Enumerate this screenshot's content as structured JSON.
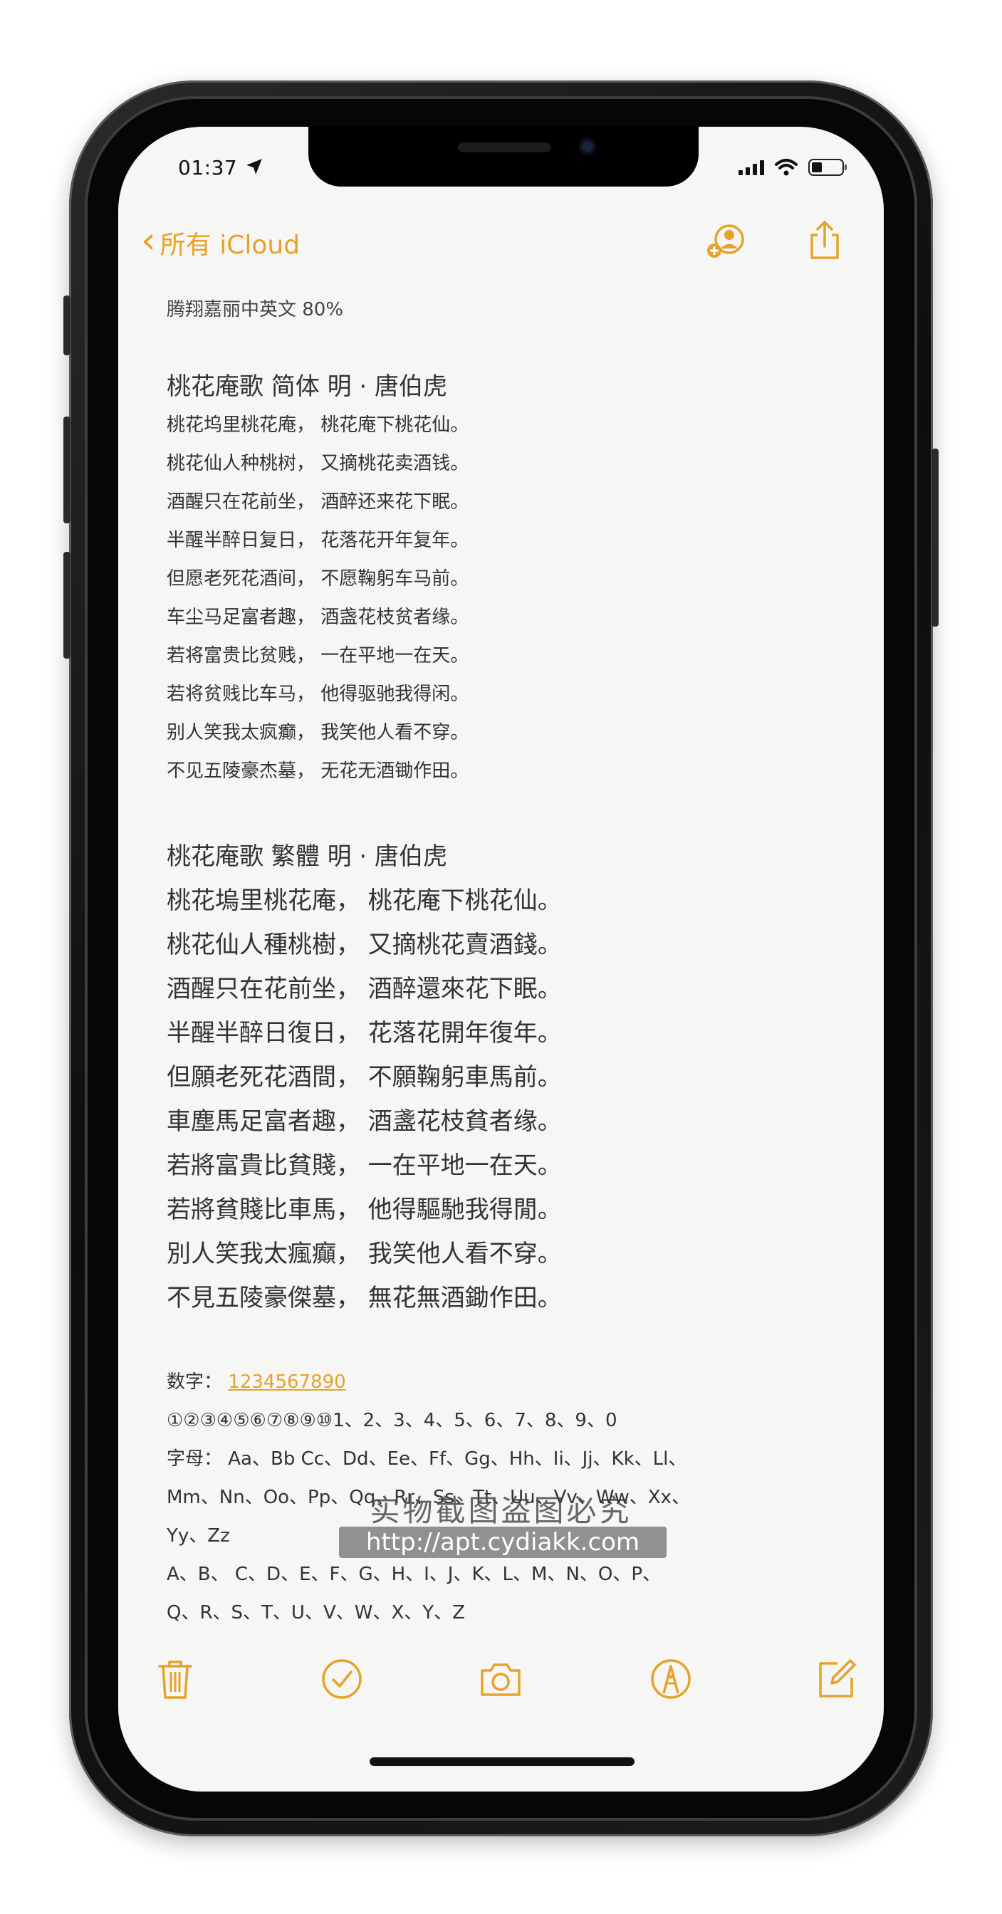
{
  "status": {
    "time": "01:37"
  },
  "nav": {
    "back_label": "所有 iCloud"
  },
  "note": {
    "font_info": "腾翔嘉丽中英文 80%",
    "simplified_title": "桃花庵歌  简体    明 · 唐伯虎",
    "simplified_lines": [
      "桃花坞里桃花庵，  桃花庵下桃花仙。",
      "桃花仙人种桃树，  又摘桃花卖酒钱。",
      "酒醒只在花前坐，  酒醉还来花下眠。",
      "半醒半醉日复日，  花落花开年复年。",
      "但愿老死花酒间，  不愿鞠躬车马前。",
      "车尘马足富者趣，  酒盏花枝贫者缘。",
      "若将富贵比贫贱，  一在平地一在天。",
      "若将贫贱比车马，  他得驱驰我得闲。",
      "别人笑我太疯癫，  我笑他人看不穿。",
      "不见五陵豪杰墓，  无花无酒锄作田。"
    ],
    "traditional_title": "桃花庵歌  繁體      明 · 唐伯虎",
    "traditional_lines": [
      "桃花塢里桃花庵，  桃花庵下桃花仙。",
      "桃花仙人種桃樹，  又摘桃花賣酒錢。",
      "酒醒只在花前坐，  酒醉還來花下眠。",
      "半醒半醉日復日，  花落花開年復年。",
      "但願老死花酒間，  不願鞠躬車馬前。",
      "車塵馬足富者趣，  酒盞花枝貧者缘。",
      "若將富貴比貧賤，  一在平地一在天。",
      "若將貧賤比車馬，  他得驅馳我得閒。",
      "別人笑我太瘋癲，  我笑他人看不穿。",
      "不見五陵豪傑墓，  無花無酒鋤作田。"
    ],
    "digits_label": "数字：",
    "digits_link": "1234567890",
    "circled_line": "①②③④⑤⑥⑦⑧⑨⑩1、2、3、4、5、6、7、8、9、0",
    "letters_line1": "字母：  Aa、Bb Cc、Dd、Ee、Ff、Gg、Hh、Ii、Jj、Kk、Ll、",
    "letters_line2": "Mm、Nn、Oo、Pp、Qq、Rr、Ss、Tt、Uu、Vv、Ww、Xx、",
    "letters_line3": "Yy、Zz",
    "upper_line1": "A、B、 C、D、E、F、G、H、I、J、K、L、M、N、O、P、",
    "upper_line2": "Q、R、S、T、U、V、W、X、Y、Z"
  },
  "watermark": {
    "line1": "实物截图盗图必究",
    "line2": "http://apt.cydiakk.com"
  },
  "theme": {
    "accent": "#e5a32a",
    "paper": "#f6f6f4"
  },
  "icons": [
    "location-arrow-icon",
    "cellular-signal-icon",
    "wifi-icon",
    "battery-icon",
    "chevron-left-icon",
    "add-person-icon",
    "share-icon",
    "trash-icon",
    "checklist-icon",
    "camera-icon",
    "markup-pen-icon",
    "compose-icon"
  ]
}
